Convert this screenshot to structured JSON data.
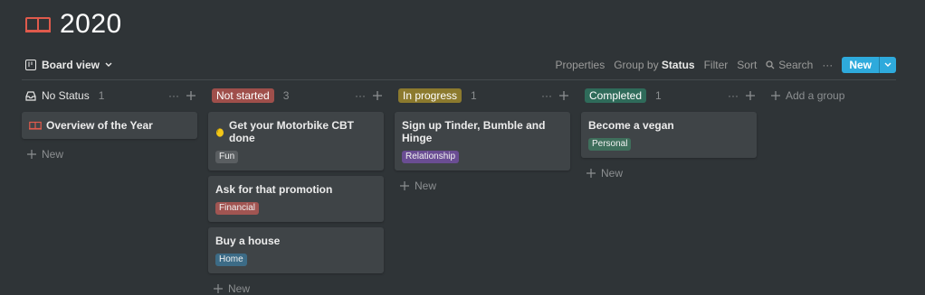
{
  "page": {
    "title": "2020"
  },
  "toolbar": {
    "view_label": "Board view",
    "properties": "Properties",
    "group_by_prefix": "Group by",
    "group_by_value": "Status",
    "filter": "Filter",
    "sort": "Sort",
    "search": "Search",
    "more": "···",
    "new": "New"
  },
  "columns": [
    {
      "name": "No Status",
      "count": "1",
      "color": "",
      "cards": [
        {
          "title": "Overview of the Year",
          "icon": "book-icon"
        }
      ],
      "new_label": "New"
    },
    {
      "name": "Not started",
      "count": "3",
      "color": "#9f4f4b",
      "cards": [
        {
          "title": "Get your Motorbike CBT done",
          "icon": "lemon-icon",
          "tag": "Fun",
          "tag_color": "#5a5e61"
        },
        {
          "title": "Ask for that promotion",
          "tag": "Financial",
          "tag_color": "#a15552"
        },
        {
          "title": "Buy a house",
          "tag": "Home",
          "tag_color": "#3c6b86"
        }
      ],
      "new_label": "New"
    },
    {
      "name": "In progress",
      "count": "1",
      "color": "#8c7a2e",
      "cards": [
        {
          "title": "Sign up Tinder, Bumble and Hinge",
          "tag": "Relationship",
          "tag_color": "#6a4d93"
        }
      ],
      "new_label": "New"
    },
    {
      "name": "Completed",
      "count": "1",
      "color": "#2f6b5a",
      "cards": [
        {
          "title": "Become a vegan",
          "tag": "Personal",
          "tag_color": "#3f6f5c"
        }
      ],
      "new_label": "New"
    }
  ],
  "add_group": "Add a group",
  "colors": {
    "background": "#2f3437",
    "card": "#3f4447",
    "accent": "#2eaadc"
  }
}
